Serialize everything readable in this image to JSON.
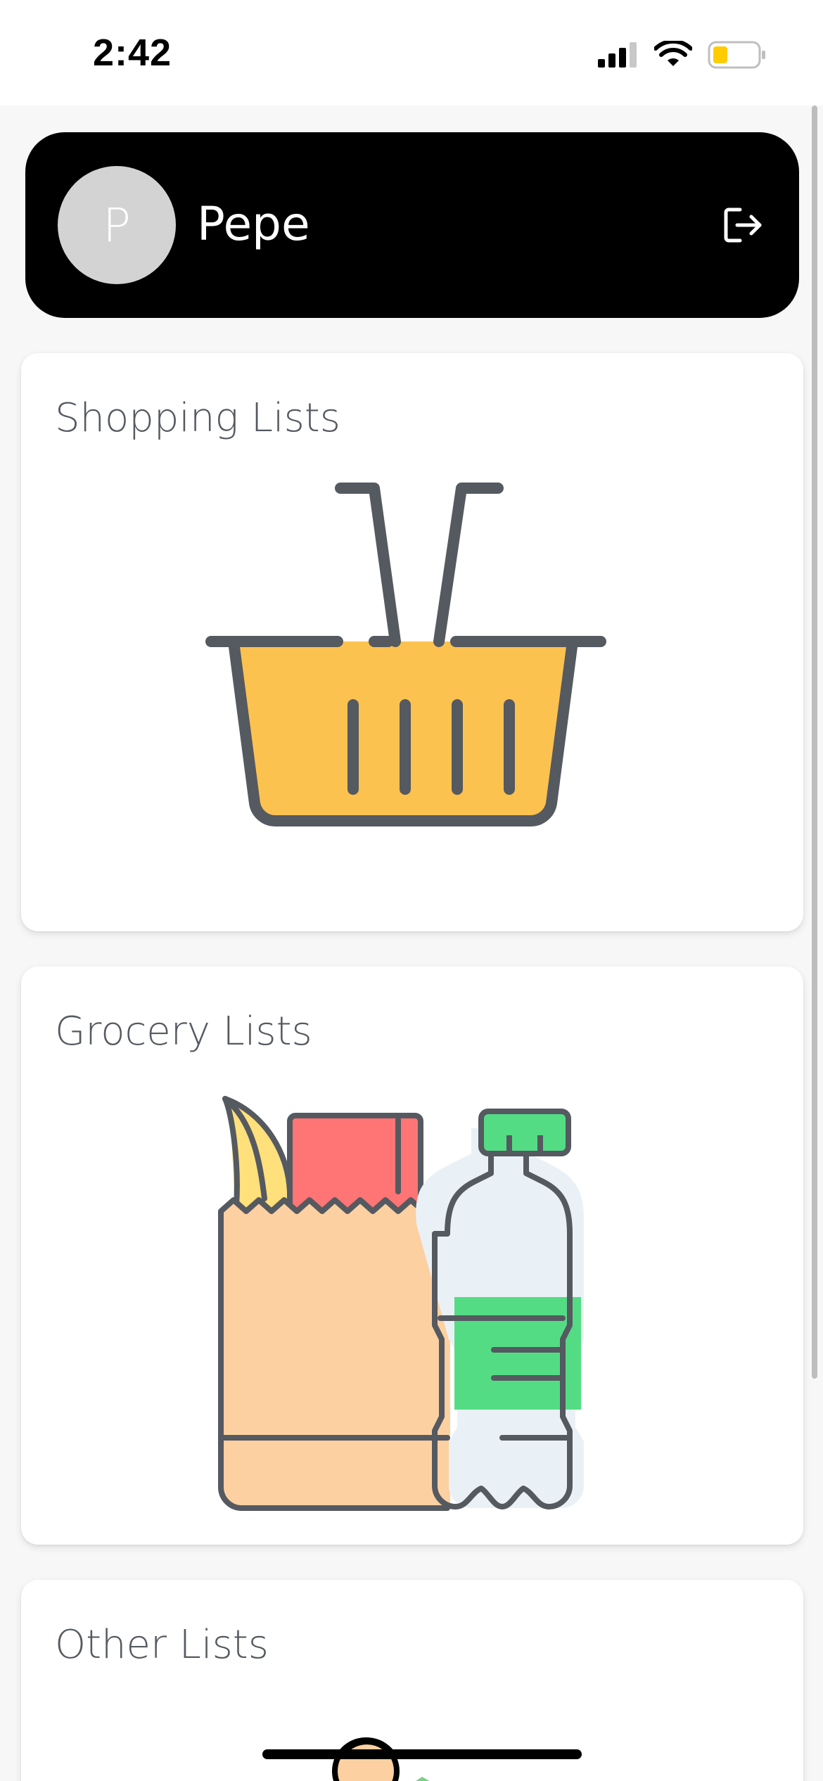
{
  "status_bar": {
    "time": "2:42"
  },
  "profile": {
    "avatar_initial": "P",
    "name": "Pepe"
  },
  "cards": [
    {
      "title": "Shopping Lists",
      "icon": "shopping-basket-icon"
    },
    {
      "title": "Grocery Lists",
      "icon": "grocery-bag-icon"
    },
    {
      "title": "Other Lists",
      "icon": "other-lists-icon"
    }
  ],
  "colors": {
    "header_bg": "#000000",
    "avatar_bg": "#d3d3d3",
    "basket_yellow": "#fcc250",
    "outline": "#555960",
    "bag": "#fcd0a1",
    "box_red": "#ff7575",
    "bottle_green": "#54dc84",
    "bottle_body": "#eaf1f6"
  }
}
